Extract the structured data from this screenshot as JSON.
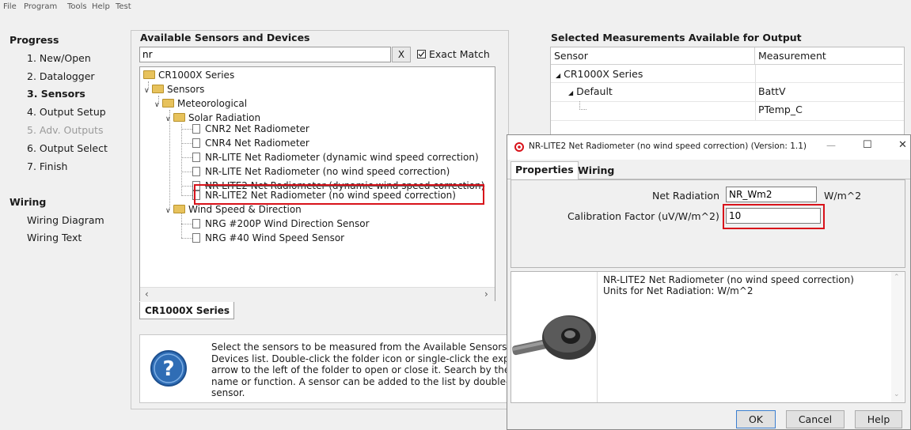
{
  "menu": [
    "File",
    "Program",
    "Tools",
    "Help",
    "Test"
  ],
  "progress": {
    "title": "Progress",
    "items": [
      {
        "label": "1. New/Open",
        "state": "normal"
      },
      {
        "label": "2. Datalogger",
        "state": "normal"
      },
      {
        "label": "3. Sensors",
        "state": "active"
      },
      {
        "label": "4. Output Setup",
        "state": "normal"
      },
      {
        "label": "5. Adv. Outputs",
        "state": "disabled"
      },
      {
        "label": "6. Output Select",
        "state": "normal"
      },
      {
        "label": "7. Finish",
        "state": "normal"
      }
    ]
  },
  "wiring": {
    "title": "Wiring",
    "items": [
      "Wiring Diagram",
      "Wiring Text"
    ]
  },
  "available": {
    "title": "Available Sensors and Devices",
    "search_value": "nr",
    "clear_label": "X",
    "exact_match_label": "Exact Match",
    "exact_match_checked": true,
    "tree": {
      "root": "CR1000X Series",
      "sensors": "Sensors",
      "meteorological": "Meteorological",
      "solar": "Solar Radiation",
      "solar_items": [
        "CNR2 Net Radiometer",
        "CNR4 Net Radiometer",
        "NR-LITE Net Radiometer (dynamic wind speed correction)",
        "NR-LITE Net Radiometer (no wind speed correction)",
        "NR-LITE2 Net Radiometer (dynamic wind speed correction)",
        "NR-LITE2 Net Radiometer (no wind speed correction)"
      ],
      "wind": "Wind Speed & Direction",
      "wind_items": [
        "NRG #200P Wind Direction Sensor",
        "NRG #40 Wind Speed Sensor"
      ]
    },
    "tab_label": "CR1000X Series",
    "help_text": "Select the sensors to be measured from the Available Sensors and Devices list. Double-click the folder icon or single-click the expansion arrow to the left of the folder to open or close it. Search by the device name or function. A sensor can be added to the list by double-clicking the sensor."
  },
  "selected": {
    "title": "Selected Measurements Available for Output",
    "columns": [
      "Sensor",
      "Measurement"
    ],
    "rows": [
      {
        "sensor": "CR1000X Series",
        "measurement": ""
      },
      {
        "sensor": "Default",
        "measurement": "BattV"
      },
      {
        "sensor": "",
        "measurement": "PTemp_C"
      }
    ]
  },
  "dialog": {
    "title": "NR-LITE2 Net Radiometer (no wind speed correction) (Version: 1.1)",
    "minimize": "—",
    "maximize": "☐",
    "close": "✕",
    "tabs": [
      "Properties",
      "Wiring"
    ],
    "net_radiation_label": "Net Radiation",
    "net_radiation_value": "NR_Wm2",
    "net_radiation_unit": "W/m^2",
    "cal_factor_label": "Calibration Factor (uV/W/m^2)",
    "cal_factor_value": "10",
    "desc_line1": "NR-LITE2 Net Radiometer (no wind speed correction)",
    "desc_line2": "Units for Net Radiation: W/m^2",
    "buttons": {
      "ok": "OK",
      "cancel": "Cancel",
      "help": "Help"
    }
  },
  "colors": {
    "highlight_red": "#d8121a",
    "folder_yellow": "#e7c25c",
    "help_icon_blue": "#2f6db5"
  }
}
